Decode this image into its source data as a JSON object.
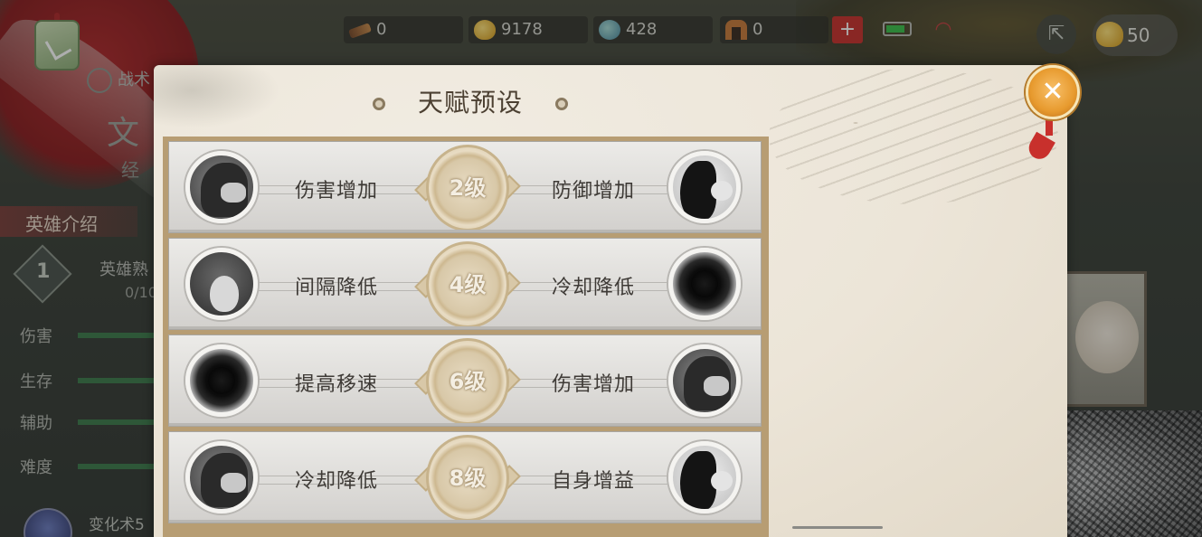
{
  "resources": {
    "items": [
      {
        "icon": "fuse-icon",
        "value": "0"
      },
      {
        "icon": "gold-ingot-icon",
        "value": "9178"
      },
      {
        "icon": "jade-icon",
        "value": "428"
      },
      {
        "icon": "gate-token-icon",
        "value": "0"
      }
    ],
    "plus_label": "+",
    "coins": "50"
  },
  "sidebar": {
    "tactics_label": "战术",
    "hero_glyph": "文",
    "sub_glyph": "经",
    "hero_tab": "英雄介绍",
    "hero_level": "1",
    "proficiency_label": "英雄熟",
    "proficiency_value": "0/10",
    "stats": [
      "伤害",
      "生存",
      "辅助",
      "难度"
    ],
    "skill_label": "变化术5"
  },
  "modal": {
    "title": "天赋预设",
    "close_label": "✕",
    "rows": [
      {
        "left_icon": "warrior-icon",
        "left": "伤害增加",
        "level": "2级",
        "right": "防御增加",
        "right_icon": "beast-mask-icon"
      },
      {
        "left_icon": "drop-icon",
        "left": "间隔降低",
        "level": "4级",
        "right": "冷却降低",
        "right_icon": "vortex-icon"
      },
      {
        "left_icon": "vortex-icon",
        "left": "提高移速",
        "level": "6级",
        "right": "伤害增加",
        "right_icon": "warrior-icon"
      },
      {
        "left_icon": "warrior-icon",
        "left": "冷却降低",
        "level": "8级",
        "right": "自身增益",
        "right_icon": "beast-mask-icon"
      }
    ]
  }
}
